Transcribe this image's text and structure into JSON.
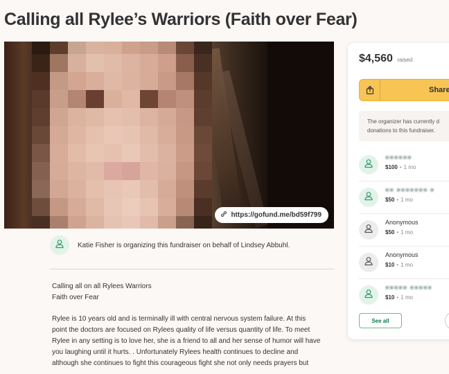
{
  "page": {
    "title": "Calling all Rylee’s Warriors (Faith over Fear)"
  },
  "hero": {
    "short_url": "https://gofund.me/bd59f799",
    "mosaic": [
      [
        "#2a1a10",
        "#5e3d2c",
        "#c8a590",
        "#d9b3a0",
        "#d8b09c",
        "#cfa28e",
        "#c79c89",
        "#b88a78",
        "#6a4636",
        "#3a261c"
      ],
      [
        "#3a2418",
        "#a07660",
        "#d7b19e",
        "#e3c0ae",
        "#e0bba8",
        "#dcb4a1",
        "#d6ac99",
        "#cf9f8c",
        "#8a5e4c",
        "#4a3024"
      ],
      [
        "#4d3022",
        "#c39a86",
        "#d2a691",
        "#d9ae9a",
        "#e0b9a6",
        "#dcb3a0",
        "#d6ab98",
        "#c99a86",
        "#a87866",
        "#563828"
      ],
      [
        "#5a3a2a",
        "#c89d89",
        "#b58574",
        "#6a3e30",
        "#d9b09c",
        "#e0b8a5",
        "#6e4434",
        "#b58472",
        "#c0907c",
        "#5c3c2c"
      ],
      [
        "#5e3e2e",
        "#d0a591",
        "#dcb39f",
        "#e0b9a6",
        "#e6c1af",
        "#e4bead",
        "#ddb4a1",
        "#d5aa97",
        "#c69885",
        "#5f3f2f"
      ],
      [
        "#6a4838",
        "#d4aa96",
        "#dfb6a3",
        "#e5c0ae",
        "#e9c6b5",
        "#e7c3b2",
        "#e0b9a7",
        "#d8ae9b",
        "#c89a86",
        "#6a4838"
      ],
      [
        "#7a5646",
        "#d7ad99",
        "#e2bba9",
        "#e8c4b3",
        "#e6c1b0",
        "#eac8b8",
        "#e3bdab",
        "#dbb29f",
        "#cb9d89",
        "#6e4b3b"
      ],
      [
        "#83604f",
        "#d6ac98",
        "#deb5a3",
        "#e2baa9",
        "#dca9a0",
        "#d8a39b",
        "#e0b6a6",
        "#dab09e",
        "#c69884",
        "#6a4737"
      ],
      [
        "#8a6756",
        "#d2a793",
        "#dbb19f",
        "#e4bfae",
        "#e7c4b3",
        "#e9c8b8",
        "#e3bdac",
        "#d6ab98",
        "#bf917d",
        "#5a3b2c"
      ],
      [
        "#6e4d3d",
        "#c49883",
        "#d6ac99",
        "#e0b9a7",
        "#e8c6b6",
        "#ebccbd",
        "#e6c3b3",
        "#d8ae9b",
        "#b78a76",
        "#4a2f22"
      ],
      [
        "#4a3022",
        "#a9806c",
        "#cfa38f",
        "#dcb3a1",
        "#e6c2b2",
        "#e9c7b8",
        "#e1baa9",
        "#caa08c",
        "#8a6452",
        "#38241a"
      ]
    ]
  },
  "organizer": {
    "text": "Katie Fisher is organizing this fundraiser on behalf of Lindsey Abbuhl."
  },
  "story": {
    "lines_1": [
      "Calling all on all Rylees Warriors",
      "Faith over Fear"
    ],
    "lines_2": [
      "Rylee is 10 years old and is terminally ill with central nervous system failure. At this",
      "point the doctors are focused on Rylees quality of life versus quantity of life. To meet",
      "Rylee in any setting is to love her, she is a friend to all and her sense of humor will have",
      "you laughing until it hurts. . Unfortunately Rylees health continues to decline and",
      "although she continues to fight this courageous fight she not only needs prayers but"
    ]
  },
  "sidebar": {
    "raised_amount": "$4,560",
    "raised_label": "raised",
    "share_label": "Share",
    "notice_line1": "The organizer has currently d",
    "notice_line2": "donations to this fundraiser.",
    "see_all_label": "See all",
    "donations": [
      {
        "name": "■■■■■■",
        "blurred": true,
        "amount": "$100",
        "time": "1 mo",
        "icon": "green"
      },
      {
        "name": "■■ ■■■■■■■ ■",
        "blurred": true,
        "amount": "$50",
        "time": "1 mo",
        "icon": "green"
      },
      {
        "name": "Anonymous",
        "blurred": false,
        "amount": "$50",
        "time": "1 mo",
        "icon": "gray"
      },
      {
        "name": "Anonymous",
        "blurred": false,
        "amount": "$10",
        "time": "1 mo",
        "icon": "gray"
      },
      {
        "name": "■■■■■ ■■■■■",
        "blurred": true,
        "amount": "$10",
        "time": "1 mo",
        "icon": "green"
      }
    ]
  }
}
